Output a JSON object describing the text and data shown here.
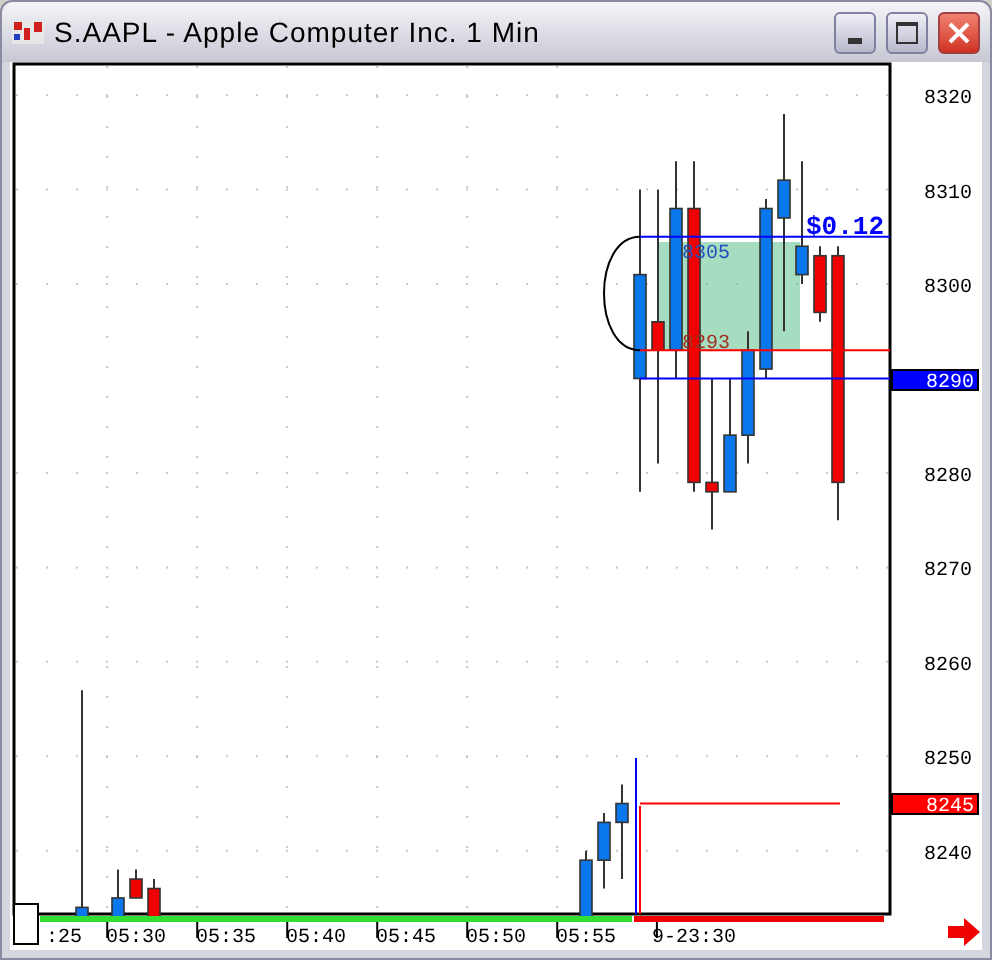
{
  "window": {
    "title": "S.AAPL - Apple Computer Inc. 1 Min"
  },
  "chart": {
    "chart_data": {
      "type": "candlestick",
      "ylim": [
        8233.3,
        8323.3
      ],
      "grid": true,
      "categories": [
        null,
        null,
        null,
        ":25",
        null,
        null,
        null,
        "05:30",
        null,
        null,
        null,
        null,
        "05:35",
        null,
        null,
        null,
        null,
        "05:40",
        null,
        null,
        null,
        null,
        "05:45",
        null,
        null,
        null,
        null,
        "05:50",
        null,
        null,
        null,
        null,
        "05:55",
        null,
        null,
        null,
        null,
        null,
        "9-23:30",
        null,
        null,
        null,
        null,
        null,
        null,
        null,
        null,
        null,
        null
      ],
      "ohlc": [
        null,
        null,
        null,
        null,
        [
          8233,
          8257,
          8233,
          8234
        ],
        null,
        [
          8233,
          8238,
          8233,
          8235
        ],
        [
          8237,
          8238,
          8235,
          8235
        ],
        [
          8236,
          8237,
          8233,
          8233
        ],
        null,
        null,
        null,
        null,
        null,
        null,
        null,
        null,
        null,
        null,
        null,
        null,
        null,
        null,
        null,
        null,
        null,
        null,
        null,
        null,
        null,
        null,
        null,
        [
          8233,
          8240,
          8233,
          8239
        ],
        [
          8239,
          8244,
          8236,
          8243
        ],
        [
          8243,
          8247,
          8237,
          8245
        ],
        [
          8290,
          8310,
          8278,
          8301
        ],
        [
          8296,
          8310,
          8281,
          8293
        ],
        [
          8293,
          8313,
          8290,
          8308
        ],
        [
          8308,
          8313,
          8278,
          8279
        ],
        [
          8279,
          8290,
          8274,
          8278
        ],
        [
          8278,
          8290,
          8278,
          8284
        ],
        [
          8284,
          8295,
          8281,
          8293
        ],
        [
          8291,
          8309,
          8290,
          8308
        ],
        [
          8307,
          8318,
          8295,
          8311
        ],
        [
          8301,
          8313,
          8300,
          8304
        ],
        [
          8303,
          8304,
          8296,
          8297
        ],
        [
          8303,
          8304,
          8275,
          8279
        ],
        null,
        null
      ],
      "yticks": [
        8320,
        8310,
        8300,
        8280,
        8270,
        8260,
        8250,
        8240
      ],
      "ref_lines": [
        {
          "axis": "y",
          "value": 8305,
          "color": "#0000ff"
        },
        {
          "axis": "y",
          "value": 8293,
          "color": "#ff0000"
        },
        {
          "axis": "y",
          "value": 8290,
          "color": "#0000ff"
        },
        {
          "axis": "y",
          "value": 8245,
          "color": "#ff0000"
        }
      ]
    }
  },
  "price_tags": [
    {
      "label": "8290",
      "color": "#0000ff"
    },
    {
      "label": "8245",
      "color": "#ff0000"
    }
  ],
  "annotations": {
    "high": "8305",
    "low": "8293",
    "change": "$0.12"
  }
}
